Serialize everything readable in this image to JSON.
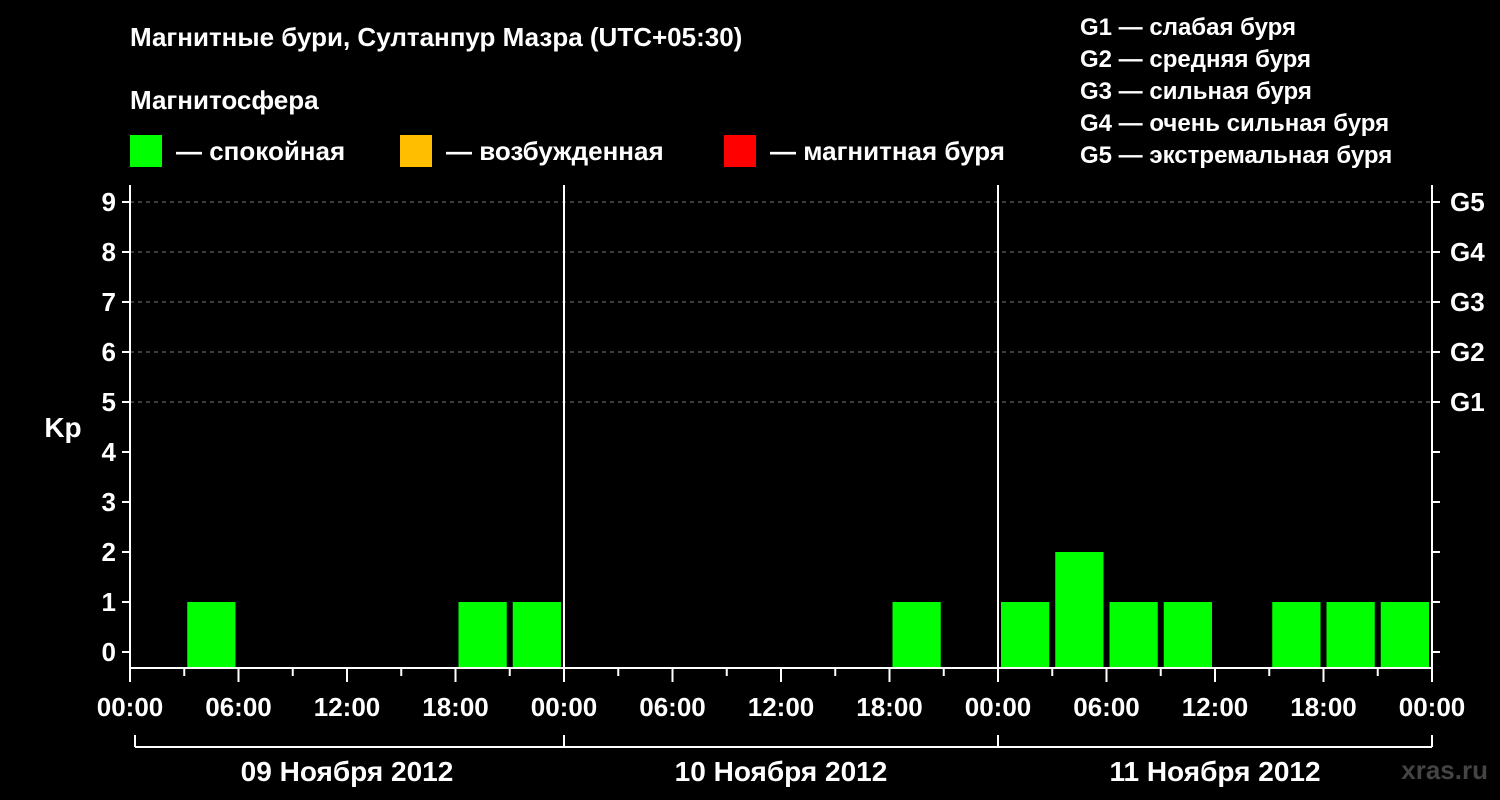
{
  "chart_data": {
    "type": "bar",
    "title": "Магнитные бури, Султанпур Мазра (UTC+05:30)",
    "ylabel": "Kp",
    "ylim": [
      0,
      9
    ],
    "y_ticks": [
      "0",
      "1",
      "2",
      "3",
      "4",
      "5",
      "6",
      "7",
      "8",
      "9"
    ],
    "right_ticks": [
      {
        "kp": 5,
        "label": "G1"
      },
      {
        "kp": 6,
        "label": "G2"
      },
      {
        "kp": 7,
        "label": "G3"
      },
      {
        "kp": 8,
        "label": "G4"
      },
      {
        "kp": 9,
        "label": "G5"
      }
    ],
    "x_tick_labels": [
      "00:00",
      "06:00",
      "12:00",
      "18:00",
      "00:00",
      "06:00",
      "12:00",
      "18:00",
      "00:00",
      "06:00",
      "12:00",
      "18:00",
      "00:00"
    ],
    "days": [
      "09 Ноября 2012",
      "10 Ноября 2012",
      "11 Ноября 2012"
    ],
    "grid": "horizontal dashed at Kp 5–9",
    "legend_title": "Магнитосфера",
    "legend": [
      {
        "color": "#00ff00",
        "label": "— спокойная"
      },
      {
        "color": "#ffbf00",
        "label": "— возбужденная"
      },
      {
        "color": "#ff0000",
        "label": "— магнитная буря"
      }
    ],
    "g_levels": [
      "G1 — слабая буря",
      "G2 — средняя буря",
      "G3 — сильная буря",
      "G4 — очень сильная буря",
      "G5 — экстремальная буря"
    ],
    "bars": [
      {
        "day": 0,
        "start_hour": 3,
        "value": 1
      },
      {
        "day": 0,
        "start_hour": 18,
        "value": 1
      },
      {
        "day": 0,
        "start_hour": 21,
        "value": 1
      },
      {
        "day": 1,
        "start_hour": 18,
        "value": 1
      },
      {
        "day": 2,
        "start_hour": 0,
        "value": 1
      },
      {
        "day": 2,
        "start_hour": 3,
        "value": 2
      },
      {
        "day": 2,
        "start_hour": 6,
        "value": 1
      },
      {
        "day": 2,
        "start_hour": 9,
        "value": 1
      },
      {
        "day": 2,
        "start_hour": 15,
        "value": 1
      },
      {
        "day": 2,
        "start_hour": 18,
        "value": 1
      },
      {
        "day": 2,
        "start_hour": 21,
        "value": 1
      }
    ],
    "bar_color": "#00ff00"
  },
  "watermark": "xras.ru"
}
